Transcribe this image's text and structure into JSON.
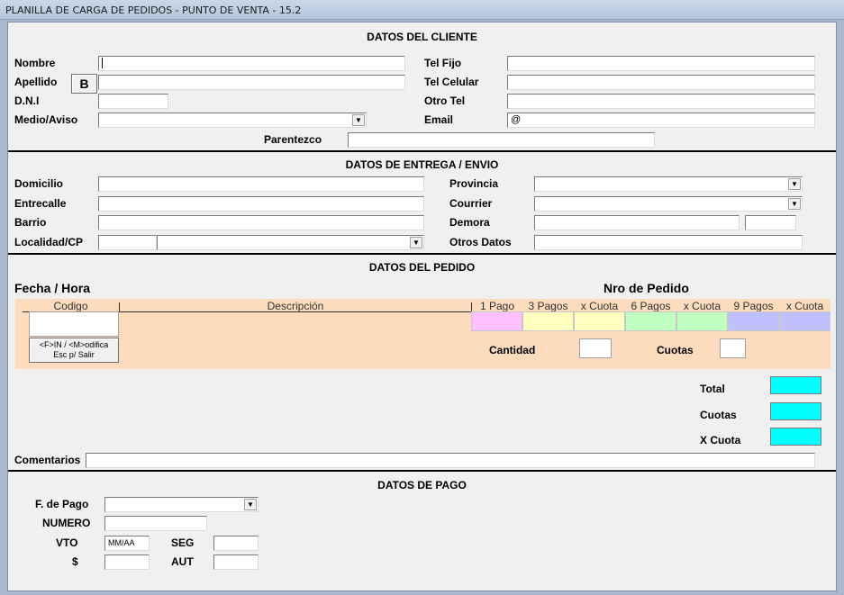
{
  "window": {
    "title": "PLANILLA DE CARGA DE PEDIDOS - PUNTO DE VENTA - 15.2"
  },
  "cliente": {
    "header": "DATOS DEL CLIENTE",
    "nombre_label": "Nombre",
    "apellido_label": "Apellido",
    "b_button": "B",
    "dni_label": "D.N.I",
    "medio_label": "Medio/Aviso",
    "tel_fijo_label": "Tel Fijo",
    "tel_celular_label": "Tel Celular",
    "otro_tel_label": "Otro Tel",
    "email_label": "Email",
    "email_value": "@",
    "parentezco_label": "Parentezco"
  },
  "entrega": {
    "header": "DATOS DE ENTREGA / ENVIO",
    "domicilio_label": "Domicilio",
    "entrecalle_label": "Entrecalle",
    "barrio_label": "Barrio",
    "localidad_label": "Localidad/CP",
    "provincia_label": "Provincia",
    "courrier_label": "Courrier",
    "demora_label": "Demora",
    "otros_label": "Otros Datos"
  },
  "pedido": {
    "header": "DATOS DEL PEDIDO",
    "fecha_label": "Fecha  / Hora",
    "nro_label": "Nro de Pedido",
    "columns": {
      "codigo": "Codigo",
      "descripcion": "Descripción",
      "pago1": "1 Pago",
      "pagos3": "3 Pagos",
      "xcuota1": "x Cuota",
      "pagos6": "6 Pagos",
      "xcuota2": "x Cuota",
      "pagos9": "9 Pagos",
      "xcuota3": "x Cuota"
    },
    "hint_line1": "<F>IN / <M>odifica",
    "hint_line2": "Esc p/ Salir",
    "cantidad_label": "Cantidad",
    "cuotas_label": "Cuotas",
    "total_label": "Total",
    "sum_cuotas_label": "Cuotas",
    "xcuota_label": "X Cuota",
    "comentarios_label": "Comentarios"
  },
  "pago": {
    "header": "DATOS DE PAGO",
    "fpago_label": "F. de Pago",
    "numero_label": "NUMERO",
    "vto_label": "VTO",
    "vto_value": "MM/AA",
    "seg_label": "SEG",
    "monto_label": "$",
    "aut_label": "AUT"
  },
  "colors": {
    "panel_bg": "#fcdcbc",
    "pago1": "#ffbfff",
    "pagos3": "#ffffc0",
    "pagos6": "#c0ffc0",
    "pagos9": "#c0c0ff",
    "summary": "#00ffff"
  },
  "icons": {
    "dropdown": "chevron-down-icon"
  }
}
